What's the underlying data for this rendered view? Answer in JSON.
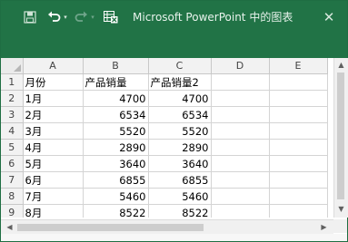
{
  "window": {
    "title": "Microsoft PowerPoint 中的图表",
    "close_glyph": "✕",
    "accent_color": "#217346"
  },
  "toolbar": {
    "icons": [
      "save-icon",
      "undo-icon",
      "dropdown-arrow-icon",
      "redo-icon",
      "edit-data-in-excel-icon"
    ]
  },
  "sheet": {
    "columns": [
      "A",
      "B",
      "C",
      "D",
      "E"
    ],
    "rows": [
      {
        "num": "1",
        "cells": [
          "月份",
          "产品销量",
          "产品销量2",
          "",
          ""
        ]
      },
      {
        "num": "2",
        "cells": [
          " 1月",
          "4700",
          "4700",
          "",
          ""
        ]
      },
      {
        "num": "3",
        "cells": [
          " 2月",
          "6534",
          "6534",
          "",
          ""
        ]
      },
      {
        "num": "4",
        "cells": [
          " 3月",
          "5520",
          "5520",
          "",
          ""
        ]
      },
      {
        "num": "5",
        "cells": [
          " 4月",
          "2890",
          "2890",
          "",
          ""
        ]
      },
      {
        "num": "6",
        "cells": [
          "5月",
          "3640",
          "3640",
          "",
          ""
        ]
      },
      {
        "num": "7",
        "cells": [
          "6月",
          "6855",
          "6855",
          "",
          ""
        ]
      },
      {
        "num": "8",
        "cells": [
          "7月",
          "5460",
          "5460",
          "",
          ""
        ]
      },
      {
        "num": "9",
        "cells": [
          "8月",
          "8522",
          "8522",
          "",
          ""
        ]
      }
    ]
  },
  "scrollbars": {
    "up": "▲",
    "down": "▼",
    "left": "◀",
    "right": "▶"
  }
}
